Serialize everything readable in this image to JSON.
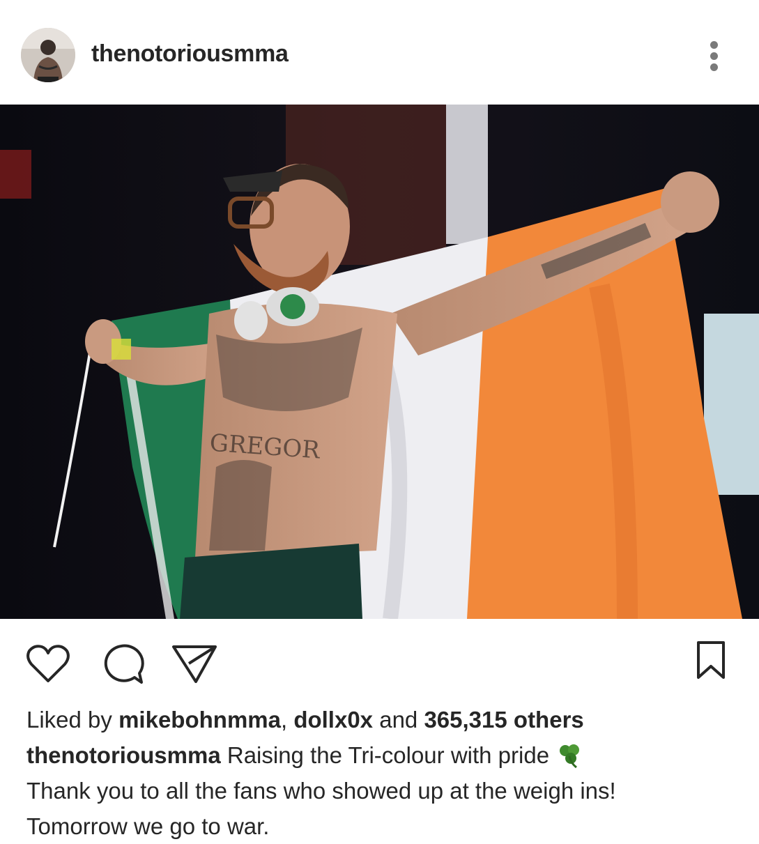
{
  "post": {
    "username": "thenotoriousmma",
    "photo_description_icon": "photo"
  },
  "likes": {
    "prefix": "Liked by ",
    "user1": "mikebohnmma",
    "sep": ", ",
    "user2": "dollx0x",
    "and": " and ",
    "count": "365,315 others"
  },
  "caption": {
    "author": "thenotoriousmma",
    "line1": " Raising the Tri-colour with pride ",
    "line2": "Thank you to all the fans who showed up at the weigh ins!",
    "line3": "Tomorrow we go to war."
  },
  "icons": {
    "like": "heart-icon",
    "comment": "comment-icon",
    "share": "send-icon",
    "save": "bookmark-icon",
    "more": "more-options-icon",
    "emoji": "shamrock-icon"
  },
  "colors": {
    "flag_green": "#1f7a4f",
    "flag_white": "#eeeef2",
    "flag_orange": "#f2883a",
    "shamrock": "#3f8a2e"
  }
}
